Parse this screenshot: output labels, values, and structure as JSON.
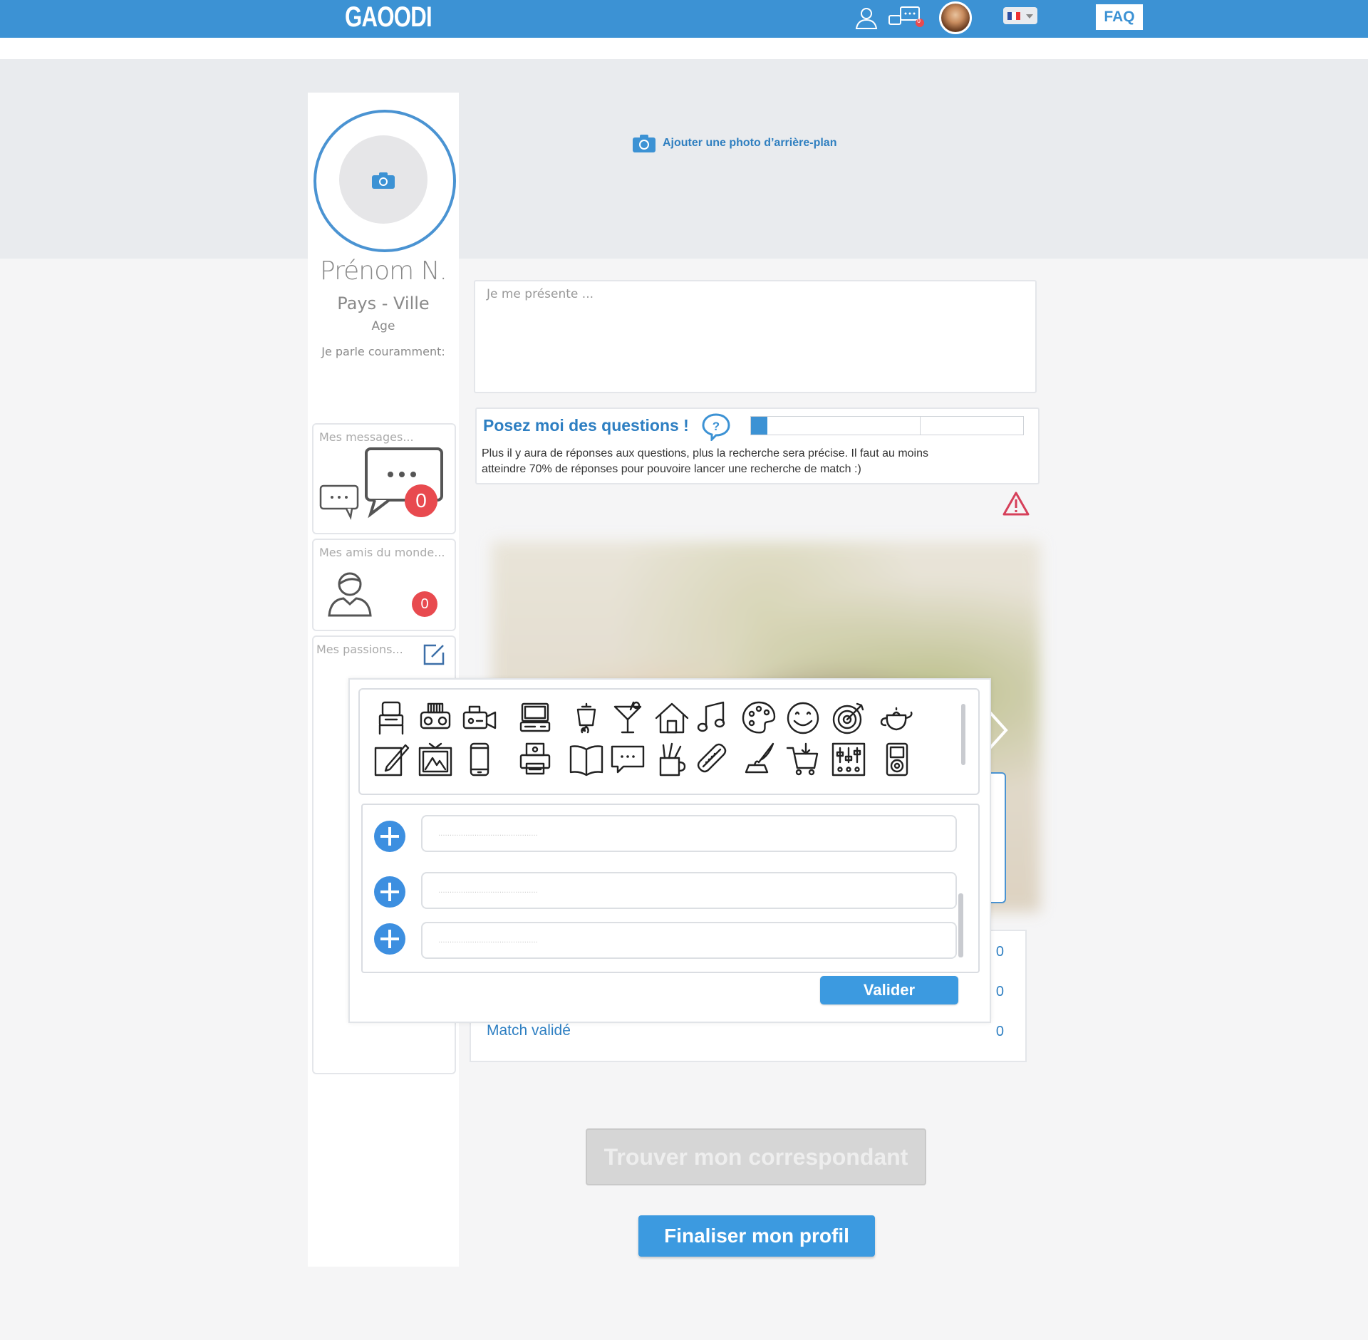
{
  "header": {
    "logo": "GAOODI",
    "profile_icon": "user-icon",
    "messages_icon": "chat-icon",
    "messages_count": "0",
    "language_flag": "fr-flag",
    "faq_label": "FAQ"
  },
  "banner": {
    "add_background_label": "Ajouter une photo d’arrière-plan"
  },
  "profile": {
    "name": "Prénom N.",
    "place": "Pays - Ville",
    "age": "Age",
    "languages": "Je parle couramment:"
  },
  "sidebar": {
    "messages_title": "Mes messages...",
    "messages_count": "0",
    "friends_title": "Mes amis du monde...",
    "friends_count": "0",
    "passions_title": "Mes passions..."
  },
  "intro": {
    "placeholder": "Je me présente ..."
  },
  "questions": {
    "title": "Posez moi des questions !",
    "text": "Plus il y aura de réponses aux questions, plus la recherche sera précise. Il faut au moins atteindre 70% de réponses pour pouvoire lancer une recherche de match :)",
    "progress_fraction": 0.06,
    "threshold_fraction": 0.62
  },
  "stats": {
    "rows": [
      {
        "label": "",
        "value": "0"
      },
      {
        "label": "",
        "value": "0"
      },
      {
        "label": "Match  validé",
        "value": "0"
      }
    ]
  },
  "passions_popup": {
    "icons": [
      "seat-icon",
      "boombox-icon",
      "camcorder-icon",
      "computer-icon",
      "cooking-pot-icon",
      "cocktail-icon",
      "house-icon",
      "music-note-icon",
      "palette-icon",
      "smiley-icon",
      "target-icon",
      "teapot-icon",
      "notepad-pencil-icon",
      "painting-icon",
      "smartphone-icon",
      "printer-icon",
      "book-icon",
      "speech-bubble-icon",
      "pencil-cup-icon",
      "hotdog-icon",
      "quill-inkwell-icon",
      "shopping-cart-icon",
      "mixer-icon",
      "ipod-icon"
    ],
    "entries": [
      {
        "placeholder": "............................................"
      },
      {
        "placeholder": "............................................"
      },
      {
        "placeholder": "............................................"
      }
    ],
    "validate_label": "Valider"
  },
  "actions": {
    "find_label": "Trouver mon correspondant",
    "finalize_label": "Finaliser mon profil"
  },
  "colors": {
    "brand": "#3c92d4",
    "badge": "#e84a4f",
    "warning": "#d6405a"
  }
}
